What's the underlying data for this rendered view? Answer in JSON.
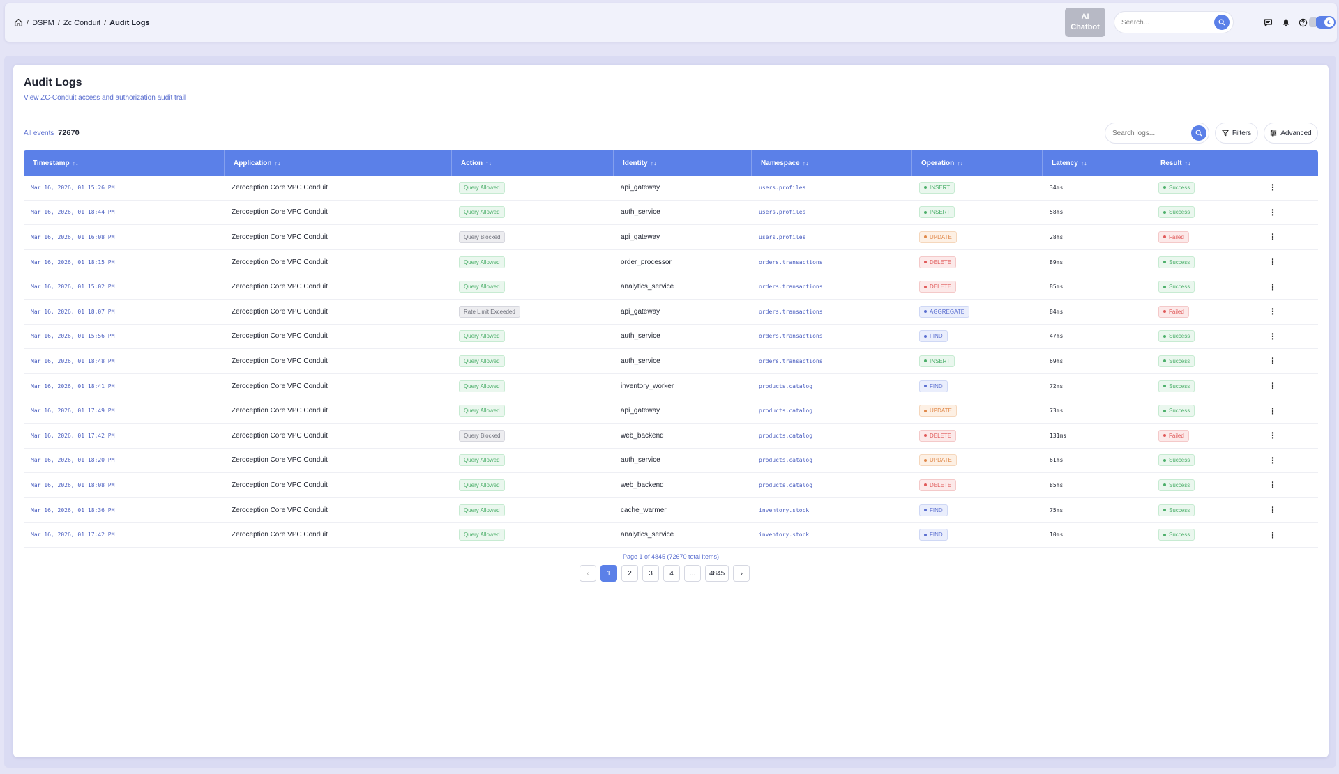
{
  "breadcrumb": [
    "DSPM",
    "Zc Conduit",
    "Audit Logs"
  ],
  "header": {
    "chatbot_line1": "AI",
    "chatbot_line2": "Chatbot",
    "search_placeholder": "Search..."
  },
  "page": {
    "title": "Audit Logs",
    "subtitle": "View ZC-Conduit access and authorization audit trail",
    "events_label": "All events",
    "events_count": "72670",
    "search_placeholder": "Search logs...",
    "filters_label": "Filters",
    "advanced_label": "Advanced"
  },
  "table": {
    "columns": [
      "Timestamp",
      "Application",
      "Action",
      "Identity",
      "Namespace",
      "Operation",
      "Latency",
      "Result"
    ],
    "rows": [
      {
        "ts": "Mar 16, 2026, 01:15:26 PM",
        "app": "Zeroception Core VPC Conduit",
        "action": "Query Allowed",
        "identity": "api_gateway",
        "ns": "users.profiles",
        "op": "INSERT",
        "lat": "34ms",
        "result": "Success"
      },
      {
        "ts": "Mar 16, 2026, 01:18:44 PM",
        "app": "Zeroception Core VPC Conduit",
        "action": "Query Allowed",
        "identity": "auth_service",
        "ns": "users.profiles",
        "op": "INSERT",
        "lat": "58ms",
        "result": "Success"
      },
      {
        "ts": "Mar 16, 2026, 01:16:08 PM",
        "app": "Zeroception Core VPC Conduit",
        "action": "Query Blocked",
        "identity": "api_gateway",
        "ns": "users.profiles",
        "op": "UPDATE",
        "lat": "28ms",
        "result": "Failed"
      },
      {
        "ts": "Mar 16, 2026, 01:18:15 PM",
        "app": "Zeroception Core VPC Conduit",
        "action": "Query Allowed",
        "identity": "order_processor",
        "ns": "orders.transactions",
        "op": "DELETE",
        "lat": "89ms",
        "result": "Success"
      },
      {
        "ts": "Mar 16, 2026, 01:15:02 PM",
        "app": "Zeroception Core VPC Conduit",
        "action": "Query Allowed",
        "identity": "analytics_service",
        "ns": "orders.transactions",
        "op": "DELETE",
        "lat": "85ms",
        "result": "Success"
      },
      {
        "ts": "Mar 16, 2026, 01:18:07 PM",
        "app": "Zeroception Core VPC Conduit",
        "action": "Rate Limit Exceeded",
        "identity": "api_gateway",
        "ns": "orders.transactions",
        "op": "AGGREGATE",
        "lat": "84ms",
        "result": "Failed"
      },
      {
        "ts": "Mar 16, 2026, 01:15:56 PM",
        "app": "Zeroception Core VPC Conduit",
        "action": "Query Allowed",
        "identity": "auth_service",
        "ns": "orders.transactions",
        "op": "FIND",
        "lat": "47ms",
        "result": "Success"
      },
      {
        "ts": "Mar 16, 2026, 01:18:48 PM",
        "app": "Zeroception Core VPC Conduit",
        "action": "Query Allowed",
        "identity": "auth_service",
        "ns": "orders.transactions",
        "op": "INSERT",
        "lat": "69ms",
        "result": "Success"
      },
      {
        "ts": "Mar 16, 2026, 01:18:41 PM",
        "app": "Zeroception Core VPC Conduit",
        "action": "Query Allowed",
        "identity": "inventory_worker",
        "ns": "products.catalog",
        "op": "FIND",
        "lat": "72ms",
        "result": "Success"
      },
      {
        "ts": "Mar 16, 2026, 01:17:49 PM",
        "app": "Zeroception Core VPC Conduit",
        "action": "Query Allowed",
        "identity": "api_gateway",
        "ns": "products.catalog",
        "op": "UPDATE",
        "lat": "73ms",
        "result": "Success"
      },
      {
        "ts": "Mar 16, 2026, 01:17:42 PM",
        "app": "Zeroception Core VPC Conduit",
        "action": "Query Blocked",
        "identity": "web_backend",
        "ns": "products.catalog",
        "op": "DELETE",
        "lat": "131ms",
        "result": "Failed"
      },
      {
        "ts": "Mar 16, 2026, 01:18:20 PM",
        "app": "Zeroception Core VPC Conduit",
        "action": "Query Allowed",
        "identity": "auth_service",
        "ns": "products.catalog",
        "op": "UPDATE",
        "lat": "61ms",
        "result": "Success"
      },
      {
        "ts": "Mar 16, 2026, 01:18:08 PM",
        "app": "Zeroception Core VPC Conduit",
        "action": "Query Allowed",
        "identity": "web_backend",
        "ns": "products.catalog",
        "op": "DELETE",
        "lat": "85ms",
        "result": "Success"
      },
      {
        "ts": "Mar 16, 2026, 01:18:36 PM",
        "app": "Zeroception Core VPC Conduit",
        "action": "Query Allowed",
        "identity": "cache_warmer",
        "ns": "inventory.stock",
        "op": "FIND",
        "lat": "75ms",
        "result": "Success"
      },
      {
        "ts": "Mar 16, 2026, 01:17:42 PM",
        "app": "Zeroception Core VPC Conduit",
        "action": "Query Allowed",
        "identity": "analytics_service",
        "ns": "inventory.stock",
        "op": "FIND",
        "lat": "10ms",
        "result": "Success"
      }
    ]
  },
  "pagination": {
    "info": "Page 1 of 4845 (72670 total items)",
    "prev": "‹",
    "pages": [
      "1",
      "2",
      "3",
      "4",
      "...",
      "4845"
    ],
    "next": "›"
  },
  "colors": {
    "accent": "#5b80e8",
    "success": "#4caf6a",
    "failed": "#e05a5a",
    "update": "#e0884a"
  }
}
